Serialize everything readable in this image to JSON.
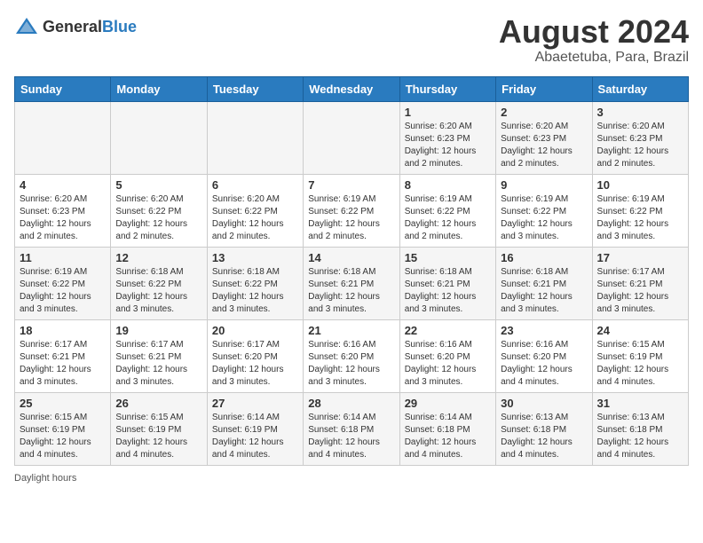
{
  "header": {
    "logo": {
      "general": "General",
      "blue": "Blue"
    },
    "title": "August 2024",
    "subtitle": "Abaetetuba, Para, Brazil"
  },
  "calendar": {
    "days_of_week": [
      "Sunday",
      "Monday",
      "Tuesday",
      "Wednesday",
      "Thursday",
      "Friday",
      "Saturday"
    ],
    "weeks": [
      [
        {
          "day": "",
          "sunrise": "",
          "sunset": "",
          "daylight": ""
        },
        {
          "day": "",
          "sunrise": "",
          "sunset": "",
          "daylight": ""
        },
        {
          "day": "",
          "sunrise": "",
          "sunset": "",
          "daylight": ""
        },
        {
          "day": "",
          "sunrise": "",
          "sunset": "",
          "daylight": ""
        },
        {
          "day": "1",
          "sunrise": "Sunrise: 6:20 AM",
          "sunset": "Sunset: 6:23 PM",
          "daylight": "Daylight: 12 hours and 2 minutes."
        },
        {
          "day": "2",
          "sunrise": "Sunrise: 6:20 AM",
          "sunset": "Sunset: 6:23 PM",
          "daylight": "Daylight: 12 hours and 2 minutes."
        },
        {
          "day": "3",
          "sunrise": "Sunrise: 6:20 AM",
          "sunset": "Sunset: 6:23 PM",
          "daylight": "Daylight: 12 hours and 2 minutes."
        }
      ],
      [
        {
          "day": "4",
          "sunrise": "Sunrise: 6:20 AM",
          "sunset": "Sunset: 6:23 PM",
          "daylight": "Daylight: 12 hours and 2 minutes."
        },
        {
          "day": "5",
          "sunrise": "Sunrise: 6:20 AM",
          "sunset": "Sunset: 6:22 PM",
          "daylight": "Daylight: 12 hours and 2 minutes."
        },
        {
          "day": "6",
          "sunrise": "Sunrise: 6:20 AM",
          "sunset": "Sunset: 6:22 PM",
          "daylight": "Daylight: 12 hours and 2 minutes."
        },
        {
          "day": "7",
          "sunrise": "Sunrise: 6:19 AM",
          "sunset": "Sunset: 6:22 PM",
          "daylight": "Daylight: 12 hours and 2 minutes."
        },
        {
          "day": "8",
          "sunrise": "Sunrise: 6:19 AM",
          "sunset": "Sunset: 6:22 PM",
          "daylight": "Daylight: 12 hours and 2 minutes."
        },
        {
          "day": "9",
          "sunrise": "Sunrise: 6:19 AM",
          "sunset": "Sunset: 6:22 PM",
          "daylight": "Daylight: 12 hours and 3 minutes."
        },
        {
          "day": "10",
          "sunrise": "Sunrise: 6:19 AM",
          "sunset": "Sunset: 6:22 PM",
          "daylight": "Daylight: 12 hours and 3 minutes."
        }
      ],
      [
        {
          "day": "11",
          "sunrise": "Sunrise: 6:19 AM",
          "sunset": "Sunset: 6:22 PM",
          "daylight": "Daylight: 12 hours and 3 minutes."
        },
        {
          "day": "12",
          "sunrise": "Sunrise: 6:18 AM",
          "sunset": "Sunset: 6:22 PM",
          "daylight": "Daylight: 12 hours and 3 minutes."
        },
        {
          "day": "13",
          "sunrise": "Sunrise: 6:18 AM",
          "sunset": "Sunset: 6:22 PM",
          "daylight": "Daylight: 12 hours and 3 minutes."
        },
        {
          "day": "14",
          "sunrise": "Sunrise: 6:18 AM",
          "sunset": "Sunset: 6:21 PM",
          "daylight": "Daylight: 12 hours and 3 minutes."
        },
        {
          "day": "15",
          "sunrise": "Sunrise: 6:18 AM",
          "sunset": "Sunset: 6:21 PM",
          "daylight": "Daylight: 12 hours and 3 minutes."
        },
        {
          "day": "16",
          "sunrise": "Sunrise: 6:18 AM",
          "sunset": "Sunset: 6:21 PM",
          "daylight": "Daylight: 12 hours and 3 minutes."
        },
        {
          "day": "17",
          "sunrise": "Sunrise: 6:17 AM",
          "sunset": "Sunset: 6:21 PM",
          "daylight": "Daylight: 12 hours and 3 minutes."
        }
      ],
      [
        {
          "day": "18",
          "sunrise": "Sunrise: 6:17 AM",
          "sunset": "Sunset: 6:21 PM",
          "daylight": "Daylight: 12 hours and 3 minutes."
        },
        {
          "day": "19",
          "sunrise": "Sunrise: 6:17 AM",
          "sunset": "Sunset: 6:21 PM",
          "daylight": "Daylight: 12 hours and 3 minutes."
        },
        {
          "day": "20",
          "sunrise": "Sunrise: 6:17 AM",
          "sunset": "Sunset: 6:20 PM",
          "daylight": "Daylight: 12 hours and 3 minutes."
        },
        {
          "day": "21",
          "sunrise": "Sunrise: 6:16 AM",
          "sunset": "Sunset: 6:20 PM",
          "daylight": "Daylight: 12 hours and 3 minutes."
        },
        {
          "day": "22",
          "sunrise": "Sunrise: 6:16 AM",
          "sunset": "Sunset: 6:20 PM",
          "daylight": "Daylight: 12 hours and 3 minutes."
        },
        {
          "day": "23",
          "sunrise": "Sunrise: 6:16 AM",
          "sunset": "Sunset: 6:20 PM",
          "daylight": "Daylight: 12 hours and 4 minutes."
        },
        {
          "day": "24",
          "sunrise": "Sunrise: 6:15 AM",
          "sunset": "Sunset: 6:19 PM",
          "daylight": "Daylight: 12 hours and 4 minutes."
        }
      ],
      [
        {
          "day": "25",
          "sunrise": "Sunrise: 6:15 AM",
          "sunset": "Sunset: 6:19 PM",
          "daylight": "Daylight: 12 hours and 4 minutes."
        },
        {
          "day": "26",
          "sunrise": "Sunrise: 6:15 AM",
          "sunset": "Sunset: 6:19 PM",
          "daylight": "Daylight: 12 hours and 4 minutes."
        },
        {
          "day": "27",
          "sunrise": "Sunrise: 6:14 AM",
          "sunset": "Sunset: 6:19 PM",
          "daylight": "Daylight: 12 hours and 4 minutes."
        },
        {
          "day": "28",
          "sunrise": "Sunrise: 6:14 AM",
          "sunset": "Sunset: 6:18 PM",
          "daylight": "Daylight: 12 hours and 4 minutes."
        },
        {
          "day": "29",
          "sunrise": "Sunrise: 6:14 AM",
          "sunset": "Sunset: 6:18 PM",
          "daylight": "Daylight: 12 hours and 4 minutes."
        },
        {
          "day": "30",
          "sunrise": "Sunrise: 6:13 AM",
          "sunset": "Sunset: 6:18 PM",
          "daylight": "Daylight: 12 hours and 4 minutes."
        },
        {
          "day": "31",
          "sunrise": "Sunrise: 6:13 AM",
          "sunset": "Sunset: 6:18 PM",
          "daylight": "Daylight: 12 hours and 4 minutes."
        }
      ]
    ]
  },
  "footer": {
    "note": "Daylight hours"
  }
}
